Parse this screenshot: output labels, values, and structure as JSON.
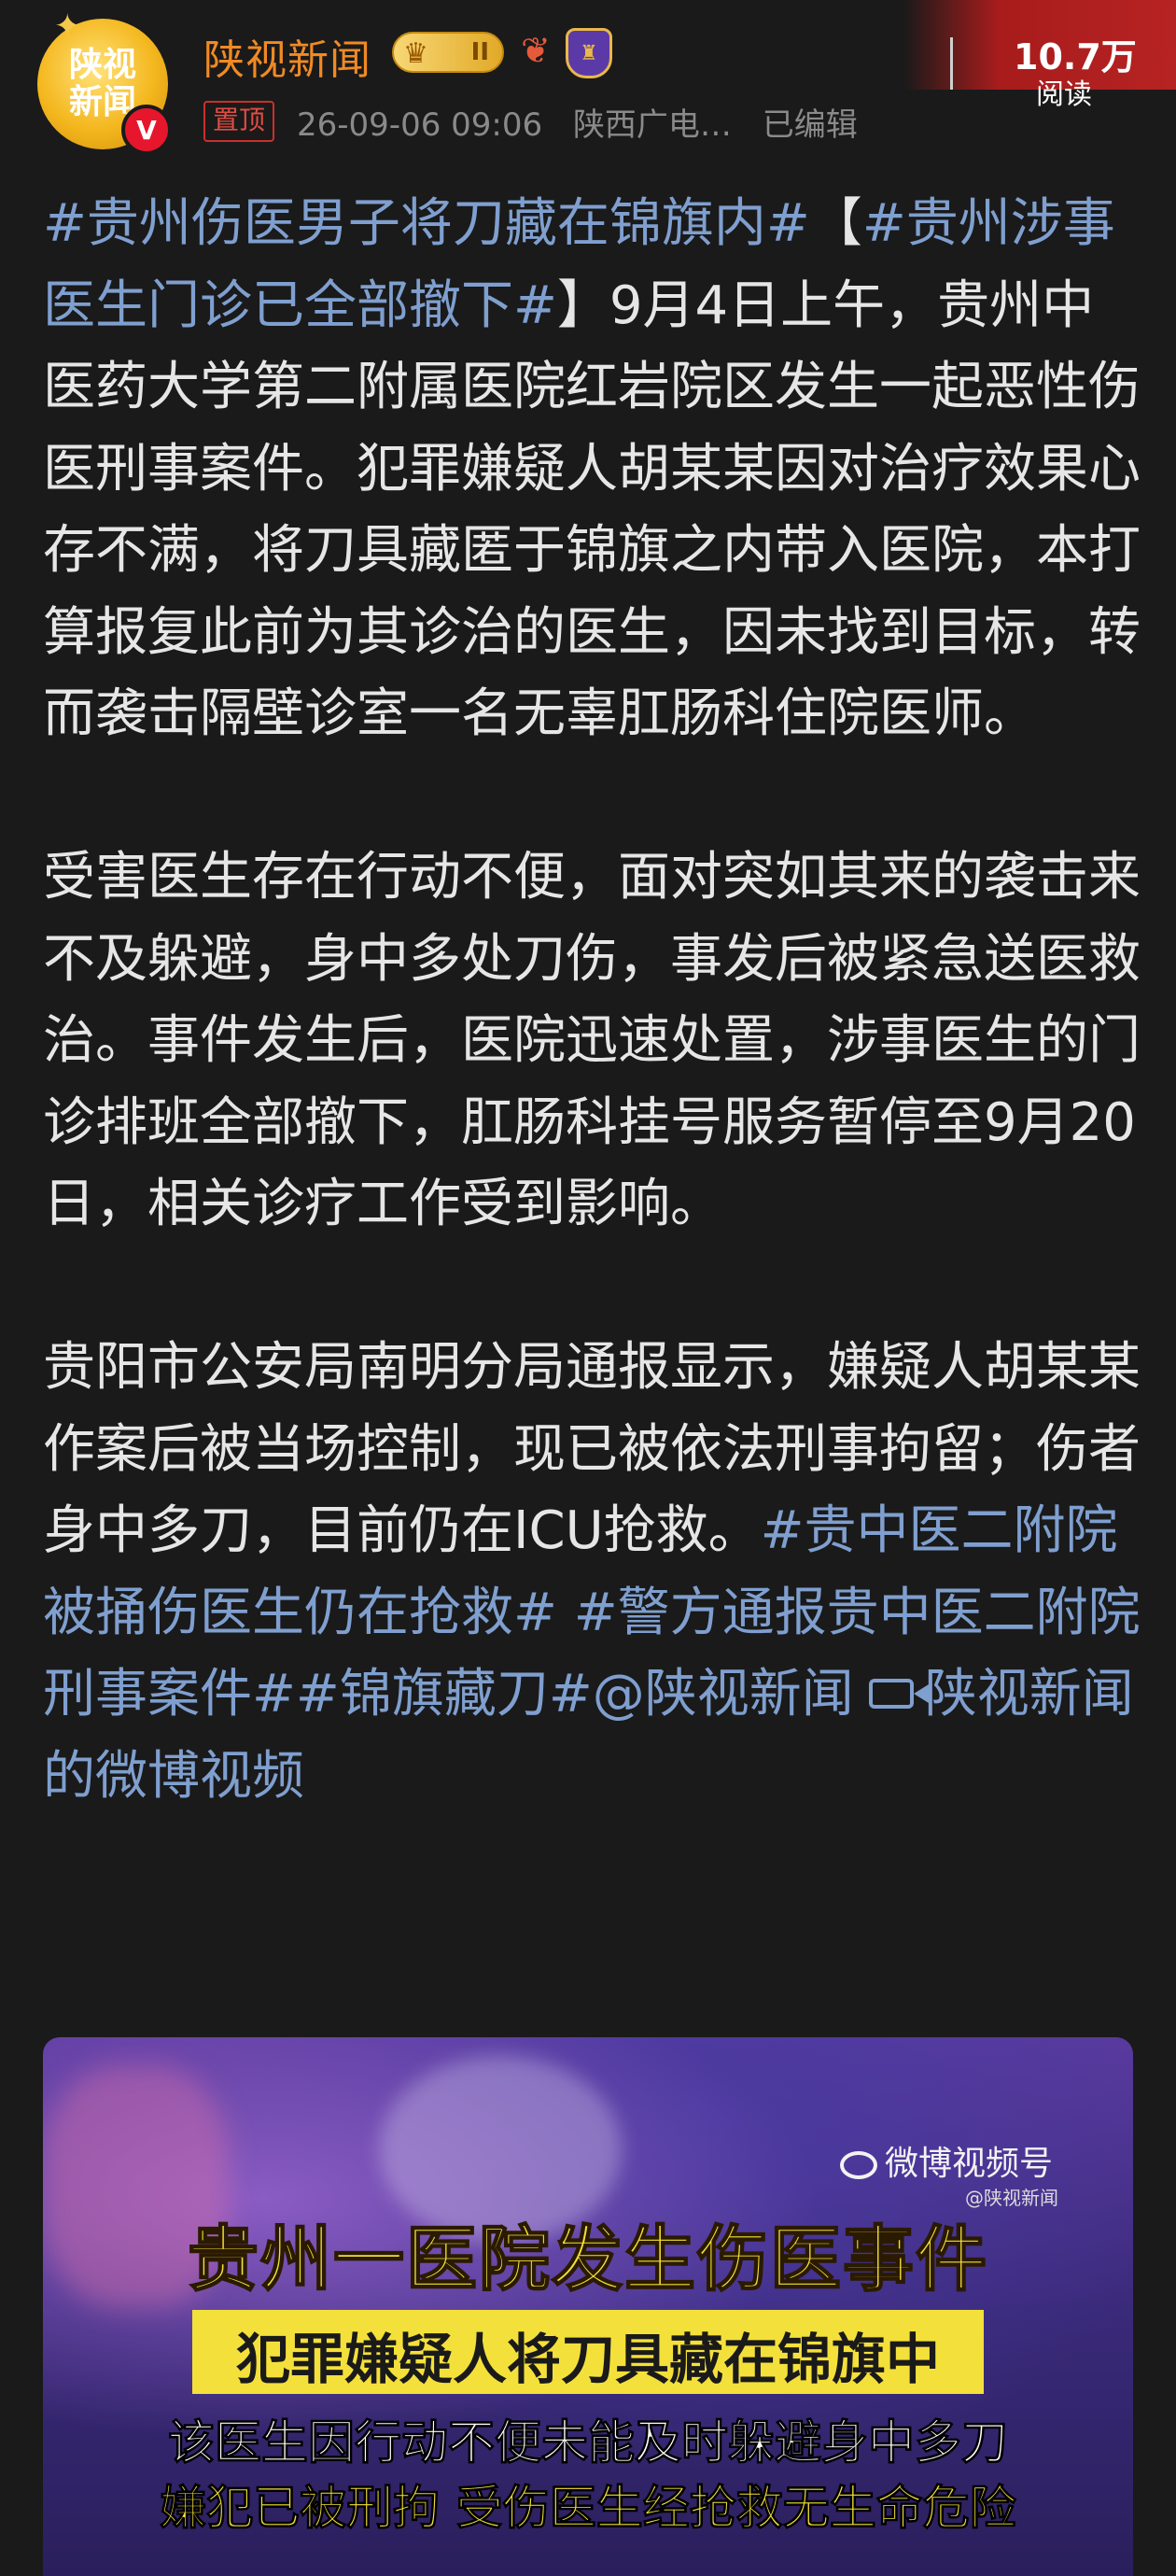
{
  "header": {
    "avatar_text_line1": "陕视",
    "avatar_text_line2": "新闻",
    "verified_badge": "V",
    "username": "陕视新闻",
    "level_badge": "II",
    "pin_tag": "置顶",
    "timestamp": "26-09-06 09:06",
    "source": "陕西广电…",
    "edited": "已编辑",
    "read_count": "10.7万",
    "read_label": "阅读",
    "icons": [
      "crown-badge-icon",
      "fire-badge-icon",
      "shield-badge-icon"
    ]
  },
  "post": {
    "p1_tag1": "#贵州伤医男子将刀藏在锦旗内#",
    "p1_bracket_open": "【",
    "p1_tag2": "#贵州涉事医生门诊已全部撤下#",
    "p1_bracket_close": "】",
    "p1_text": "9月4日上午，贵州中医药大学第二附属医院红岩院区发生一起恶性伤医刑事案件。犯罪嫌疑人胡某某因对治疗效果心存不满，将刀具藏匿于锦旗之内带入医院，本打算报复此前为其诊治的医生，因未找到目标，转而袭击隔壁诊室一名无辜肛肠科住院医师。",
    "p2_text": "受害医生存在行动不便，面对突如其来的袭击来不及躲避，身中多处刀伤，事发后被紧急送医救治。事件发生后，医院迅速处置，涉事医生的门诊排班全部撤下，肛肠科挂号服务暂停至9月20日，相关诊疗工作受到影响。",
    "p3_text": "贵阳市公安局南明分局通报显示，嫌疑人胡某某作案后被当场控制，现已被依法刑事拘留；伤者身中多刀，目前仍在ICU抢救。",
    "p3_tag1": "#贵中医二附院被捅伤医生仍在抢救#",
    "p3_tag2": "#警方通报贵中医二附院刑事案件#",
    "p3_tag3": "#锦旗藏刀#",
    "p3_mention": "@陕视新闻",
    "p3_video_link": "陕视新闻的微博视频"
  },
  "video": {
    "platform": "微博视频号",
    "platform_sub": "@陕视新闻",
    "title": "贵州一医院发生伤医事件",
    "band": "犯罪嫌疑人将刀具藏在锦旗中",
    "line1": "该医生因行动不便未能及时躲避身中多刀",
    "line2": "嫌犯已被刑拘 受伤医生经抢救无生命危险"
  },
  "colors": {
    "background": "#1a1a1a",
    "username": "#f08a24",
    "hashtag": "#7f9fcf",
    "pin": "#e04d44",
    "video_caption_yellow": "#f4e03a"
  }
}
